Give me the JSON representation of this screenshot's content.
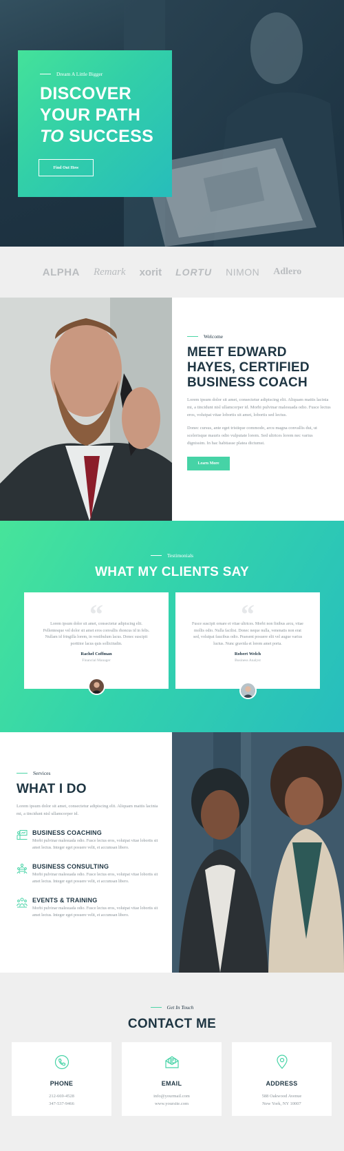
{
  "hero": {
    "eyebrow": "Dream A Little Bigger",
    "title_line1": "DISCOVER",
    "title_line2": "YOUR PATH",
    "title_line3_italic": "TO",
    "title_line3_rest": " SUCCESS",
    "button_label": "Find Out How"
  },
  "logos": [
    "ALPHA",
    "Remark",
    "xorit",
    "LORTU",
    "NIMON",
    "Adlero"
  ],
  "about": {
    "eyebrow": "Welcome",
    "title_line1": "MEET EDWARD",
    "title_line2": "HAYES, CERTIFIED",
    "title_line3": "BUSINESS COACH",
    "para1": "Lorem ipsum dolor sit amet, consectetur adipiscing elit. Aliquam mattis lacinia mi, a tincidunt nisl ullamcorper id. Morbi pulvinar malesuada odio. Fusce lectus eros, volutpat vitae lobortis sit amet, lobortis sed lectus.",
    "para2": "Donec cursus, ante eget tristique commodo, arcu magna convallis dui, ut scelerisque mauris odio vulputate lorem. Sed ultrices lorem nec varius dignissim. In hac habitasse platea dictumst.",
    "button_label": "Learn More"
  },
  "testimonials": {
    "eyebrow": "Testimonials",
    "title": "WHAT MY CLIENTS SAY",
    "items": [
      {
        "quote": "Lorem ipsum dolor sit amet, consectetur adipiscing elit. Pellentesque vel dolor sit amet eros convallis rhoncus id in felis. Nullam id fringilla lorem, in vestibulum lacus. Donec suscipit porttitor lacus quis sollicitudin.",
        "name": "Rachel Coffman",
        "role": "Financial Manager"
      },
      {
        "quote": "Fusce suscipit ornare et vitae ultrices. Morbi non finibus arcu, vitae mollis odio. Nulla facilisi. Donec neque nulla, venenatis non erat sed, volutpat faucibus odio. Praesent posuere elit vel augue varius luctus. Nunc gravida et lorem amet porta.",
        "name": "Robert Welch",
        "role": "Business Analyst"
      }
    ]
  },
  "services": {
    "eyebrow": "Services",
    "title": "WHAT I DO",
    "intro": "Lorem ipsum dolor sit amet, consectetur adipiscing elit. Aliquam mattis lacinia mi, a tincidunt nisl ullamcorper id.",
    "items": [
      {
        "title": "BUSINESS COACHING",
        "desc": "Morbi pulvinar malesuada odio. Fusce lectus eros, volutpat vitae lobortis sit amet lectus. Integer eget posuere velit, et accumsan libero."
      },
      {
        "title": "BUSINESS CONSULTING",
        "desc": "Morbi pulvinar malesuada odio. Fusce lectus eros, volutpat vitae lobortis sit amet lectus. Integer eget posuere velit, et accumsan libero."
      },
      {
        "title": "EVENTS & TRAINING",
        "desc": "Morbi pulvinar malesuada odio. Fusce lectus eros, volutpat vitae lobortis sit amet lectus. Integer eget posuere velit, et accumsan libero."
      }
    ]
  },
  "contact": {
    "eyebrow": "Get In Touch",
    "title": "CONTACT ME",
    "cards": [
      {
        "title": "PHONE",
        "line1": "212-669-4528",
        "line2": "347-537-9466"
      },
      {
        "title": "EMAIL",
        "line1": "info@yourmail.com",
        "line2": "www.yoursite.com"
      },
      {
        "title": "ADDRESS",
        "line1": "588 Oakwood Avenue",
        "line2": "New York, NY 10007"
      }
    ]
  },
  "colors": {
    "accent": "#46d3a6",
    "dark": "#1e3542",
    "gradient_start": "#44e29a",
    "gradient_end": "#27bdbb"
  }
}
